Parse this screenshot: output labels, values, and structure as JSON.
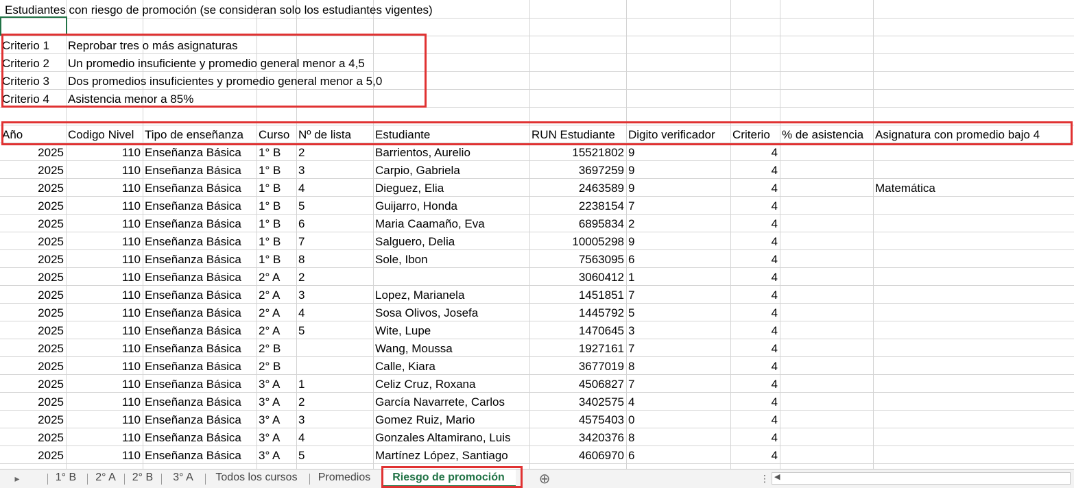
{
  "title": "Estudiantes con riesgo de promoción (se consideran solo los estudiantes vigentes)",
  "criteria": [
    {
      "label": "Criterio 1",
      "text": "Reprobar tres o más asignaturas"
    },
    {
      "label": "Criterio 2",
      "text": "Un promedio insuficiente y promedio general menor a 4,5"
    },
    {
      "label": "Criterio 3",
      "text": "Dos promedios insuficientes y promedio general menor a 5,0"
    },
    {
      "label": "Criterio 4",
      "text": "Asistencia menor a 85%"
    }
  ],
  "headers": [
    "Año",
    "Codigo Nivel",
    "Tipo de enseñanza",
    "Curso",
    "Nº de lista",
    "Estudiante",
    "RUN Estudiante",
    "Digito verificador",
    "Criterio",
    "% de asistencia",
    "Asignatura con promedio bajo 4"
  ],
  "rows": [
    [
      "2025",
      "110",
      "Enseñanza Básica",
      "1° B",
      "2",
      "Barrientos, Aurelio",
      "15521802",
      "9",
      "4",
      "",
      ""
    ],
    [
      "2025",
      "110",
      "Enseñanza Básica",
      "1° B",
      "3",
      "Carpio, Gabriela",
      "3697259",
      "9",
      "4",
      "",
      ""
    ],
    [
      "2025",
      "110",
      "Enseñanza Básica",
      "1° B",
      "4",
      "Dieguez, Elia",
      "2463589",
      "9",
      "4",
      "",
      "Matemática"
    ],
    [
      "2025",
      "110",
      "Enseñanza Básica",
      "1° B",
      "5",
      "Guijarro, Honda",
      "2238154",
      "7",
      "4",
      "",
      ""
    ],
    [
      "2025",
      "110",
      "Enseñanza Básica",
      "1° B",
      "6",
      "Maria Caamaño, Eva",
      "6895834",
      "2",
      "4",
      "",
      ""
    ],
    [
      "2025",
      "110",
      "Enseñanza Básica",
      "1° B",
      "7",
      "Salguero, Delia",
      "10005298",
      "9",
      "4",
      "",
      ""
    ],
    [
      "2025",
      "110",
      "Enseñanza Básica",
      "1° B",
      "8",
      "Sole, Ibon",
      "7563095",
      "6",
      "4",
      "",
      ""
    ],
    [
      "2025",
      "110",
      "Enseñanza Básica",
      "2° A",
      "2",
      "",
      "3060412",
      "1",
      "4",
      "",
      ""
    ],
    [
      "2025",
      "110",
      "Enseñanza Básica",
      "2° A",
      "3",
      "Lopez, Marianela",
      "1451851",
      "7",
      "4",
      "",
      ""
    ],
    [
      "2025",
      "110",
      "Enseñanza Básica",
      "2° A",
      "4",
      "Sosa Olivos, Josefa",
      "1445792",
      "5",
      "4",
      "",
      ""
    ],
    [
      "2025",
      "110",
      "Enseñanza Básica",
      "2° A",
      "5",
      "Wite, Lupe",
      "1470645",
      "3",
      "4",
      "",
      ""
    ],
    [
      "2025",
      "110",
      "Enseñanza Básica",
      "2° B",
      "",
      "Wang, Moussa",
      "1927161",
      "7",
      "4",
      "",
      ""
    ],
    [
      "2025",
      "110",
      "Enseñanza Básica",
      "2° B",
      "",
      "Calle, Kiara",
      "3677019",
      "8",
      "4",
      "",
      ""
    ],
    [
      "2025",
      "110",
      "Enseñanza Básica",
      "3° A",
      "1",
      "Celiz Cruz, Roxana",
      "4506827",
      "7",
      "4",
      "",
      ""
    ],
    [
      "2025",
      "110",
      "Enseñanza Básica",
      "3° A",
      "2",
      "García Navarrete, Carlos",
      "3402575",
      "4",
      "4",
      "",
      ""
    ],
    [
      "2025",
      "110",
      "Enseñanza Básica",
      "3° A",
      "3",
      "Gomez Ruiz, Mario",
      "4575403",
      "0",
      "4",
      "",
      ""
    ],
    [
      "2025",
      "110",
      "Enseñanza Básica",
      "3° A",
      "4",
      "Gonzales Altamirano, Luis",
      "3420376",
      "8",
      "4",
      "",
      ""
    ],
    [
      "2025",
      "110",
      "Enseñanza Básica",
      "3° A",
      "5",
      "Martínez López, Santiago",
      "4606970",
      "6",
      "4",
      "",
      ""
    ]
  ],
  "tabs": [
    "1° B",
    "2° A",
    "2° B",
    "3° A",
    "Todos los cursos",
    "Promedios",
    "Riesgo de promoción"
  ],
  "active_tab": "Riesgo de promoción",
  "colors": {
    "highlight": "#e03232",
    "accent": "#217346",
    "grid": "#d4d4d4"
  },
  "icons": {
    "prev": "scroll-left-icon",
    "add": "add-sheet-icon",
    "more": "options-icon",
    "scroll_left": "scroll-left-arrow-icon"
  }
}
